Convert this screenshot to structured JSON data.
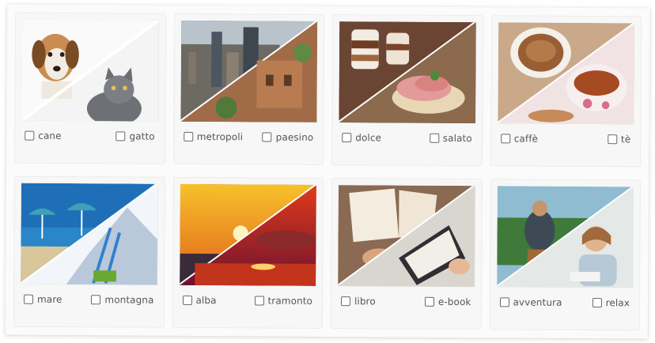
{
  "cards": [
    {
      "left": {
        "label": "cane",
        "checked": false
      },
      "right": {
        "label": "gatto",
        "checked": false
      }
    },
    {
      "left": {
        "label": "metropoli",
        "checked": false
      },
      "right": {
        "label": "paesino",
        "checked": false
      }
    },
    {
      "left": {
        "label": "dolce",
        "checked": false
      },
      "right": {
        "label": "salato",
        "checked": false
      }
    },
    {
      "left": {
        "label": "caffè",
        "checked": false
      },
      "right": {
        "label": "tè",
        "checked": false
      }
    },
    {
      "left": {
        "label": "mare",
        "checked": false
      },
      "right": {
        "label": "montagna",
        "checked": false
      }
    },
    {
      "left": {
        "label": "alba",
        "checked": false
      },
      "right": {
        "label": "tramonto",
        "checked": false
      }
    },
    {
      "left": {
        "label": "libro",
        "checked": false
      },
      "right": {
        "label": "e-book",
        "checked": false
      }
    },
    {
      "left": {
        "label": "avventura",
        "checked": false
      },
      "right": {
        "label": "relax",
        "checked": false
      }
    }
  ],
  "colors": {
    "checkbox_border": "#6a6a6a",
    "label_text": "#555555",
    "card_bg": "#f7f7f7"
  }
}
